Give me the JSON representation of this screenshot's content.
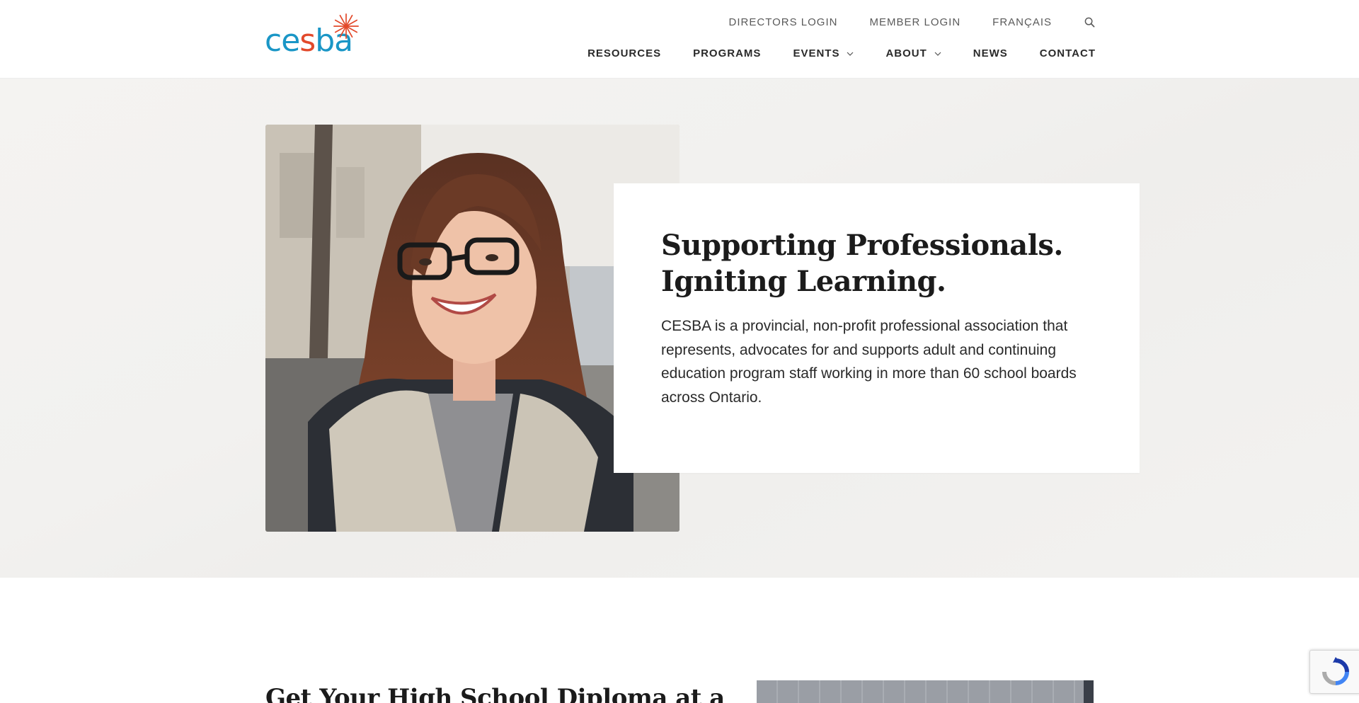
{
  "header": {
    "logo": {
      "text_part1": "ce",
      "text_part2": "s",
      "text_part3": "ba",
      "alt": "cesba"
    },
    "utility_nav": [
      {
        "label": "DIRECTORS LOGIN"
      },
      {
        "label": "MEMBER LOGIN"
      },
      {
        "label": "FRANÇAIS"
      }
    ],
    "search_icon": "search-icon",
    "main_nav": [
      {
        "label": "RESOURCES",
        "has_dropdown": false
      },
      {
        "label": "PROGRAMS",
        "has_dropdown": false
      },
      {
        "label": "EVENTS",
        "has_dropdown": true
      },
      {
        "label": "ABOUT",
        "has_dropdown": true
      },
      {
        "label": "NEWS",
        "has_dropdown": false
      },
      {
        "label": "CONTACT",
        "has_dropdown": false
      }
    ]
  },
  "hero": {
    "title_line1": "Supporting Professionals.",
    "title_line2": "Igniting Learning.",
    "body": "CESBA is a provincial, non-profit professional association that represents, advocates for and supports adult and continuing education program staff working in more than 60 school boards across Ontario."
  },
  "section2": {
    "title": "Get Your High School Diploma at a"
  },
  "colors": {
    "logo_blue": "#1a96c6",
    "logo_red": "#e2492b",
    "hero_bg": "#f2f1ef",
    "text_dark": "#1b1b1b"
  }
}
